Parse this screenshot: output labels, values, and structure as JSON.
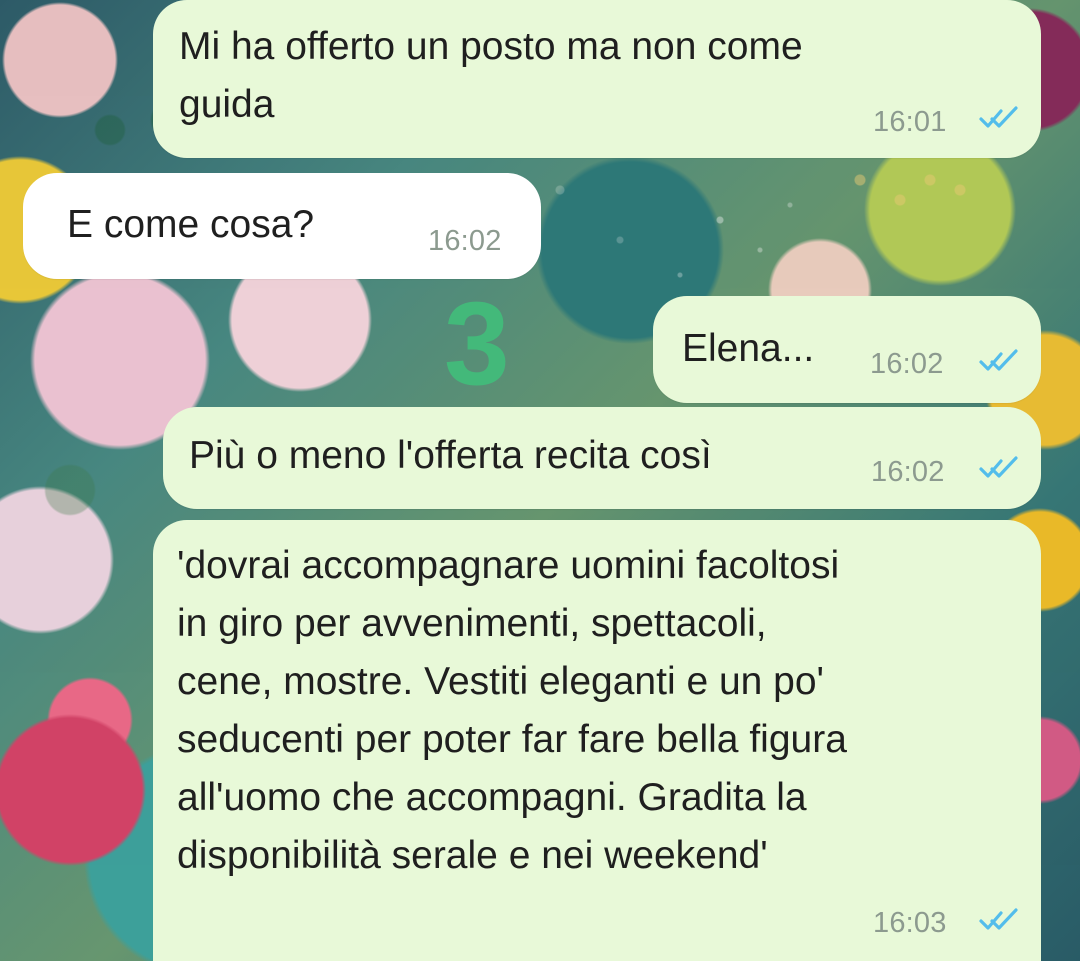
{
  "conversation": {
    "messages": [
      {
        "direction": "outgoing",
        "text": "Mi ha offerto un posto   ma non come\nguida",
        "time": "16:01",
        "status_icon": "double-check-icon",
        "status_color": "#53bdeb"
      },
      {
        "direction": "incoming",
        "text": "E come cosa?",
        "time": "16:02"
      },
      {
        "direction": "outgoing",
        "text": "Elena...",
        "time": "16:02",
        "status_icon": "double-check-icon",
        "status_color": "#53bdeb"
      },
      {
        "direction": "outgoing",
        "text": "Più o meno l'offerta recita così",
        "time": "16:02",
        "status_icon": "double-check-icon",
        "status_color": "#53bdeb"
      },
      {
        "direction": "outgoing",
        "text": "'dovrai accompagnare uomini facoltosi\nin giro per avvenimenti, spettacoli,\ncene, mostre. Vestiti eleganti e un po'\nseducenti per poter far fare bella figura\nall'uomo che accompagni. Gradita la\ndisponibilità serale e nei weekend'",
        "time": "16:03",
        "status_icon": "double-check-icon",
        "status_color": "#53bdeb"
      }
    ]
  },
  "overlay": {
    "number": "3",
    "color": "#43b97a"
  },
  "theme": {
    "outgoing_bubble": "#e8f9d8",
    "incoming_bubble": "#ffffff",
    "text": "#1f1f1f",
    "time": "#8c9a8f"
  }
}
